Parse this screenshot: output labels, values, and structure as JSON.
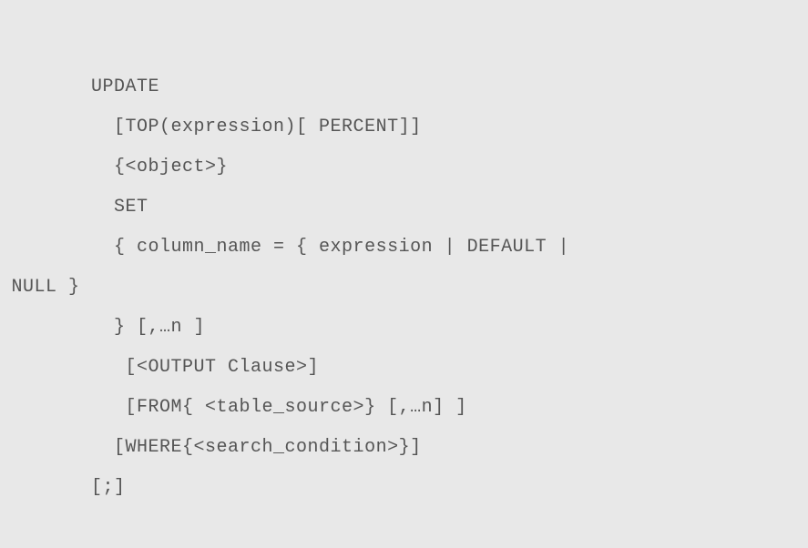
{
  "code": {
    "line1": "        UPDATE",
    "line2": "          [TOP(expression)[ PERCENT]]",
    "line3": "          {<object>}",
    "line4": "          SET",
    "line5": "          { column_name = { expression | DEFAULT |",
    "line6": " NULL }",
    "line7": "          } [,…n ]",
    "line8": "           [<OUTPUT Clause>]",
    "line9": "           [FROM{ <table_source>} [,…n] ]",
    "line10": "          [WHERE{<search_condition>}]",
    "line11": "        [;]"
  }
}
